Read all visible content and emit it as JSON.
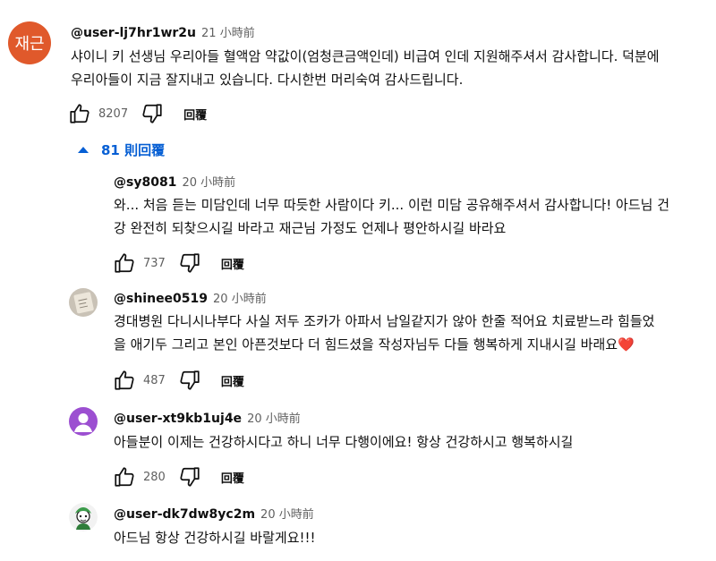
{
  "main_comment": {
    "avatar_text": "재근",
    "handle": "@user-lj7hr1wr2u",
    "time": "21 小時前",
    "text_line1": "샤이니 키 선생님 우리아들 혈액암 약값이(엄청큰금액인데) 비급여 인데 지원해주셔서 감사합니다. 덕분에",
    "text_line2": "우리아들이 지금 잘지내고 있습니다. 다시한번 머리숙여 감사드립니다.",
    "likes": "8207",
    "reply_label": "回覆"
  },
  "replies_toggle": {
    "label": "81 則回覆"
  },
  "replies": [
    {
      "handle": "@sy8081",
      "time": "20 小時前",
      "text_line1": "와... 처음 듣는 미담인데 너무 따듯한 사람이다 키... 이런 미담 공유해주셔서 감사합니다! 아드님 건",
      "text_line2": "강 완전히 되찾으시길 바라고 재근님 가정도 언제나 평안하시길 바라요",
      "likes": "737",
      "reply_label": "回覆"
    },
    {
      "handle": "@shinee0519",
      "time": "20 小時前",
      "text_line1": "경대병원 다니시나부다 사실 저두 조카가 아파서 남일같지가 않아 한줄 적어요 치료받느라 힘들었",
      "text_line2": "을 애기두 그리고 본인 아픈것보다 더 힘드셨을 작성자님두 다들 행복하게 지내시길 바래요",
      "emoji": "❤️",
      "likes": "487",
      "reply_label": "回覆"
    },
    {
      "handle": "@user-xt9kb1uj4e",
      "time": "20 小時前",
      "text_line1": "아들분이 이제는 건강하시다고 하니 너무 다행이에요! 항상 건강하시고 행복하시길",
      "likes": "280",
      "reply_label": "回覆"
    },
    {
      "handle": "@user-dk7dw8yc2m",
      "time": "20 小時前",
      "text_line1": "아드님 항상 건강하시길 바랄게요!!!"
    }
  ],
  "colors": {
    "link_blue": "#065fd4",
    "avatar_orange": "#e0592b",
    "avatar_purple": "#9c4fd1",
    "heart": "#e0245e"
  },
  "icons": [
    "thumbs-up-icon",
    "thumbs-down-icon",
    "caret-up-icon"
  ]
}
